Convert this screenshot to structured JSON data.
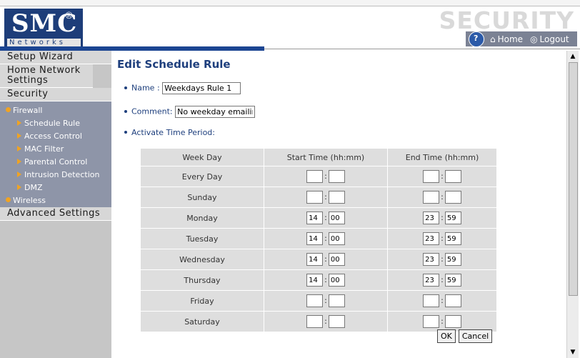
{
  "header": {
    "logo_main": "SMC",
    "logo_reg": "®",
    "logo_sub": "Networks",
    "security_label": "SECURITY",
    "nav": {
      "home": "Home",
      "logout": "Logout"
    }
  },
  "sidebar": {
    "setup_wizard": "Setup Wizard",
    "home_network": "Home Network Settings",
    "security": "Security",
    "firewall": "Firewall",
    "firewall_items": [
      "Schedule Rule",
      "Access Control",
      "MAC Filter",
      "Parental Control",
      "Intrusion Detection",
      "DMZ"
    ],
    "wireless": "Wireless",
    "advanced": "Advanced Settings"
  },
  "main": {
    "title": "Edit Schedule Rule",
    "name_label": "Name :",
    "name_value": "Weekdays Rule 1",
    "comment_label": "Comment:",
    "comment_value": "No weekday emailing",
    "activate_label": "Activate Time Period:"
  },
  "schedule": {
    "headers": [
      "Week Day",
      "Start Time (hh:mm)",
      "End Time (hh:mm)"
    ],
    "rows": [
      {
        "day": "Every Day",
        "start_h": "",
        "start_m": "",
        "end_h": "",
        "end_m": ""
      },
      {
        "day": "Sunday",
        "start_h": "",
        "start_m": "",
        "end_h": "",
        "end_m": ""
      },
      {
        "day": "Monday",
        "start_h": "14",
        "start_m": "00",
        "end_h": "23",
        "end_m": "59"
      },
      {
        "day": "Tuesday",
        "start_h": "14",
        "start_m": "00",
        "end_h": "23",
        "end_m": "59"
      },
      {
        "day": "Wednesday",
        "start_h": "14",
        "start_m": "00",
        "end_h": "23",
        "end_m": "59"
      },
      {
        "day": "Thursday",
        "start_h": "14",
        "start_m": "00",
        "end_h": "23",
        "end_m": "59"
      },
      {
        "day": "Friday",
        "start_h": "",
        "start_m": "",
        "end_h": "",
        "end_m": ""
      },
      {
        "day": "Saturday",
        "start_h": "",
        "start_m": "",
        "end_h": "",
        "end_m": ""
      }
    ]
  },
  "buttons": {
    "ok": "OK",
    "cancel": "Cancel"
  },
  "colors": {
    "brand_blue": "#1d3d79",
    "sidebar_sub": "#8e95a8",
    "accent_orange": "#f0a322"
  },
  "icons": {
    "help": "help-globe-icon",
    "home": "home-icon",
    "logout": "logout-icon"
  }
}
